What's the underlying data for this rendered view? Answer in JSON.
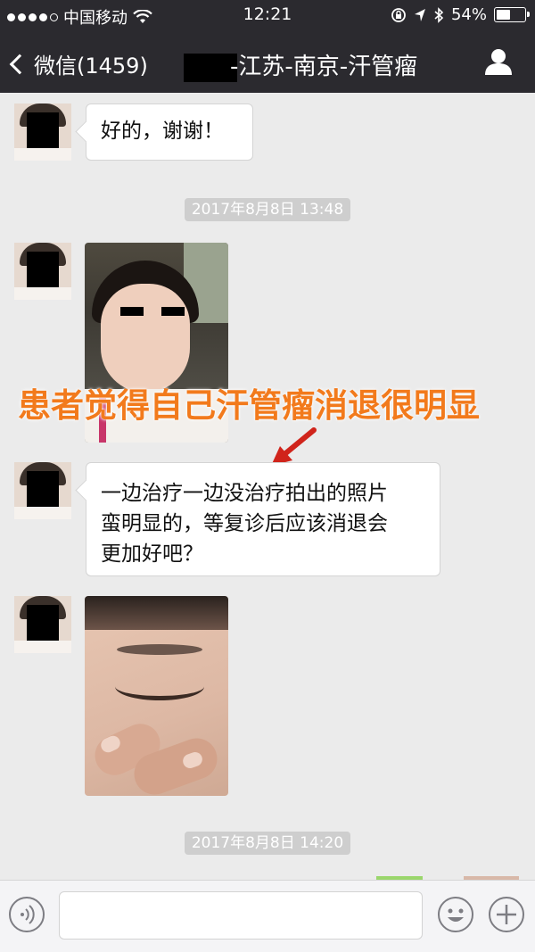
{
  "status_bar": {
    "carrier": "中国移动",
    "time": "12:21",
    "battery": "54%",
    "battery_level": 0.54,
    "icons": [
      "signal-dots-icon",
      "wifi-icon",
      "rotation-lock-icon",
      "location-icon",
      "bluetooth-icon",
      "battery-icon"
    ]
  },
  "nav": {
    "back_label": "微信(1459)",
    "title": "-江苏-南京-汗管瘤",
    "right_icon": "person-icon"
  },
  "messages": [
    {
      "type": "text",
      "lines": [
        "好的，谢谢！"
      ]
    },
    {
      "type": "timestamp",
      "text": "2017年8月8日 13:48"
    },
    {
      "type": "image",
      "description": "photo-face"
    },
    {
      "type": "text",
      "lines": [
        "一边治疗一边没治疗拍出的照片",
        "蛮明显的，等复诊后应该消退会",
        "更加好吧？"
      ]
    },
    {
      "type": "image",
      "description": "photo-eye-closeup"
    },
    {
      "type": "timestamp",
      "text": "2017年8月8日 14:20"
    }
  ],
  "annotation": {
    "text": "患者觉得自己汗管瘤消退很明显",
    "color": "#f27a1c"
  },
  "input_bar": {
    "icons": [
      "voice-icon",
      "emoji-icon",
      "plus-icon"
    ]
  },
  "colors": {
    "header_bg": "#2b2a2f",
    "chat_bg": "#ebebeb",
    "timestamp_bg": "#cecece"
  }
}
